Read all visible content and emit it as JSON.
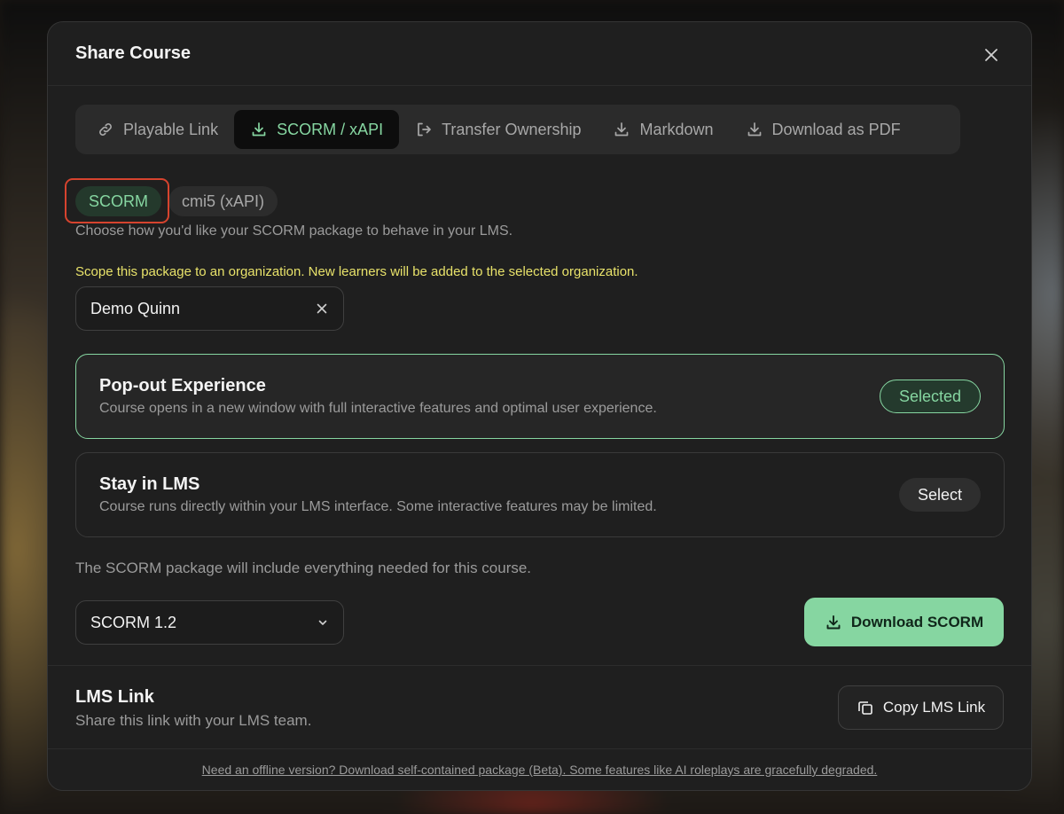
{
  "modal": {
    "title": "Share Course"
  },
  "tabs": [
    {
      "label": "Playable Link",
      "icon": "link-icon"
    },
    {
      "label": "SCORM / xAPI",
      "icon": "download-icon",
      "active": true
    },
    {
      "label": "Transfer Ownership",
      "icon": "transfer-icon"
    },
    {
      "label": "Markdown",
      "icon": "download-icon"
    },
    {
      "label": "Download as PDF",
      "icon": "download-icon"
    }
  ],
  "subtabs": [
    {
      "label": "SCORM",
      "active": true
    },
    {
      "label": "cmi5 (xAPI)"
    }
  ],
  "description": "Choose how you'd like your SCORM package to behave in your LMS.",
  "scope": {
    "note": "Scope this package to an organization. New learners will be added to the selected organization.",
    "value": "Demo Quinn"
  },
  "options": [
    {
      "title": "Pop-out Experience",
      "description": "Course opens in a new window with full interactive features and optimal user experience.",
      "button": "Selected"
    },
    {
      "title": "Stay in LMS",
      "description": "Course runs directly within your LMS interface. Some interactive features may be limited.",
      "button": "Select"
    }
  ],
  "include_note": "The SCORM package will include everything needed for this course.",
  "version": {
    "value": "SCORM 1.2"
  },
  "download_label": "Download SCORM",
  "lms": {
    "title": "LMS Link",
    "description": "Share this link with your LMS team.",
    "copy_label": "Copy LMS Link"
  },
  "footer_link": "Need an offline version? Download self-contained package (Beta). Some features like AI roleplays are gracefully degraded.",
  "colors": {
    "accent": "#86d6a1",
    "warning_text": "#e8e26a",
    "highlight_border": "#d6432e",
    "modal_bg": "#1f1f1f"
  }
}
